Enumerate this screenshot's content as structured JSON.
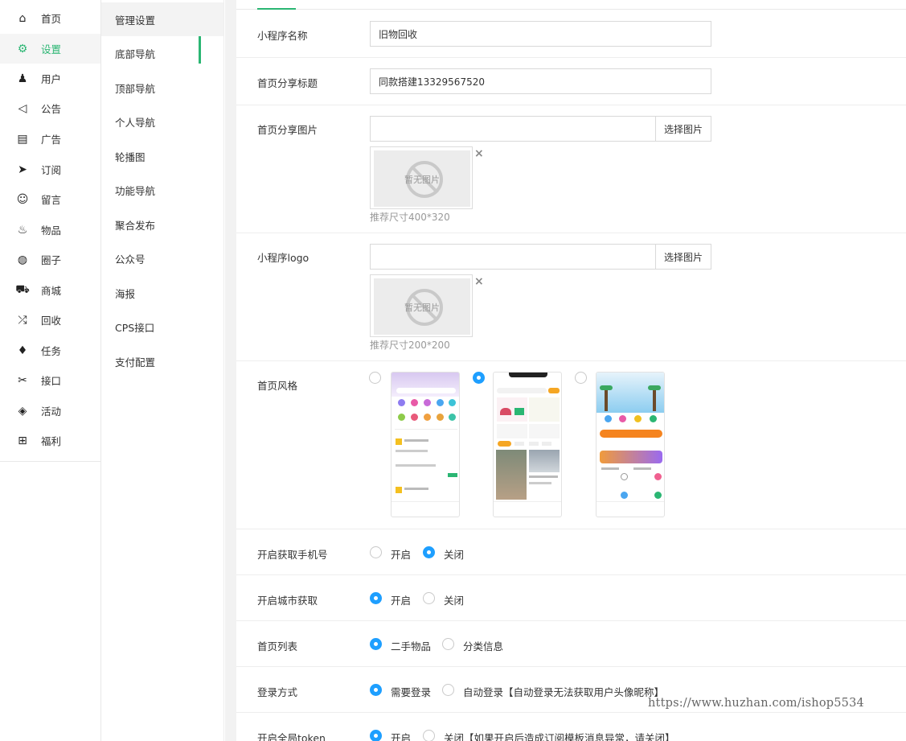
{
  "nav": [
    {
      "label": "首页",
      "icon": "home-icon",
      "glyph": "⌂"
    },
    {
      "label": "设置",
      "icon": "gear-icon",
      "glyph": "⚙"
    },
    {
      "label": "用户",
      "icon": "user-icon",
      "glyph": "♟"
    },
    {
      "label": "公告",
      "icon": "speaker-icon",
      "glyph": "◁"
    },
    {
      "label": "广告",
      "icon": "document-icon",
      "glyph": "▤"
    },
    {
      "label": "订阅",
      "icon": "send-icon",
      "glyph": "➤"
    },
    {
      "label": "留言",
      "icon": "chat-icon",
      "glyph": "☺"
    },
    {
      "label": "物品",
      "icon": "fire-icon",
      "glyph": "♨"
    },
    {
      "label": "圈子",
      "icon": "globe-icon",
      "glyph": "◍"
    },
    {
      "label": "商城",
      "icon": "cart-icon",
      "glyph": "⛟"
    },
    {
      "label": "回收",
      "icon": "shuffle-icon",
      "glyph": "⤮"
    },
    {
      "label": "任务",
      "icon": "bell-icon",
      "glyph": "♦"
    },
    {
      "label": "接口",
      "icon": "tools-icon",
      "glyph": "✂"
    },
    {
      "label": "活动",
      "icon": "diamond-icon",
      "glyph": "◈"
    },
    {
      "label": "福利",
      "icon": "gift-icon",
      "glyph": "⊞"
    }
  ],
  "nav_active": "设置",
  "subnav": [
    "管理设置",
    "底部导航",
    "顶部导航",
    "个人导航",
    "轮播图",
    "功能导航",
    "聚合发布",
    "公众号",
    "海报",
    "CPS接口",
    "支付配置"
  ],
  "form": {
    "app_name_label": "小程序名称",
    "app_name_value": "旧物回收",
    "share_title_label": "首页分享标题",
    "share_title_value": "同款搭建13329567520",
    "share_image_label": "首页分享图片",
    "share_image_hint": "推荐尺寸400*320",
    "logo_label": "小程序logo",
    "logo_hint": "推荐尺寸200*200",
    "pick_image": "选择图片",
    "no_image": "暂无图片",
    "style_label": "首页风格",
    "phone_label": "开启获取手机号",
    "city_label": "开启城市获取",
    "home_list_label": "首页列表",
    "login_label": "登录方式",
    "token_label": "开启全局token"
  },
  "options": {
    "on": "开启",
    "off": "关闭",
    "secondhand": "二手物品",
    "classified": "分类信息",
    "need_login": "需要登录",
    "auto_login": "自动登录【自动登录无法获取用户头像昵称】",
    "token_off": "关闭【如果开启后造成订阅模板消息异常，请关闭】"
  },
  "state": {
    "style_selected": 2,
    "phone": "off",
    "city": "on",
    "home_list": "secondhand",
    "login": "need_login",
    "token": "on"
  },
  "colors": {
    "accent": "#2bb673",
    "radio": "#1e9fff"
  },
  "watermark": "https://www.huzhan.com/ishop5534"
}
